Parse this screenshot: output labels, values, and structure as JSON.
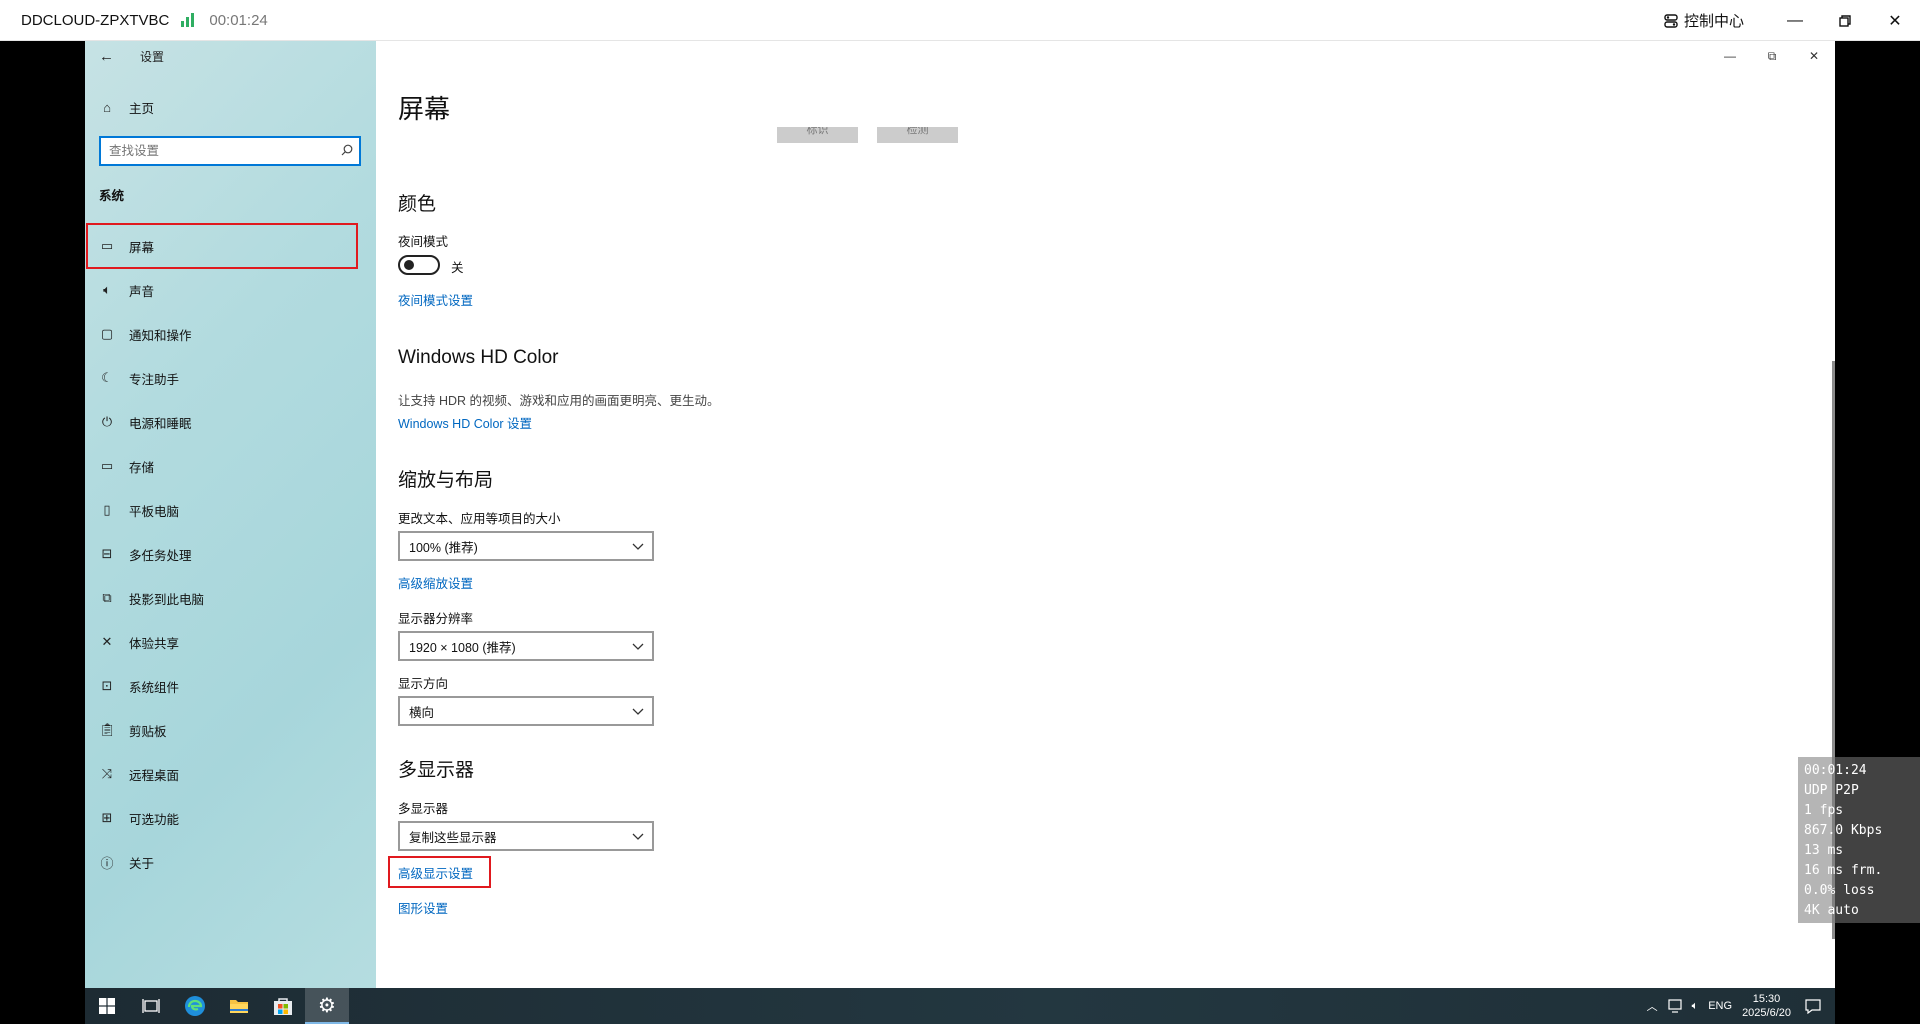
{
  "client": {
    "host": "DDCLOUD-ZPXTVBC",
    "timer": "00:01:24",
    "control_center": "控制中心",
    "signal_color": "#2fae62"
  },
  "sidebar": {
    "app_title": "设置",
    "home": "主页",
    "search_placeholder": "查找设置",
    "section": "系统",
    "items": [
      {
        "label": "屏幕",
        "icon": "monitor-icon"
      },
      {
        "label": "声音",
        "icon": "speaker-icon"
      },
      {
        "label": "通知和操作",
        "icon": "notification-icon"
      },
      {
        "label": "专注助手",
        "icon": "moon-icon"
      },
      {
        "label": "电源和睡眠",
        "icon": "power-icon"
      },
      {
        "label": "存储",
        "icon": "storage-icon"
      },
      {
        "label": "平板电脑",
        "icon": "tablet-icon"
      },
      {
        "label": "多任务处理",
        "icon": "multitask-icon"
      },
      {
        "label": "投影到此电脑",
        "icon": "project-icon"
      },
      {
        "label": "体验共享",
        "icon": "share-icon"
      },
      {
        "label": "系统组件",
        "icon": "components-icon"
      },
      {
        "label": "剪贴板",
        "icon": "clipboard-icon"
      },
      {
        "label": "远程桌面",
        "icon": "remote-desktop-icon"
      },
      {
        "label": "可选功能",
        "icon": "optional-features-icon"
      },
      {
        "label": "关于",
        "icon": "info-icon"
      }
    ]
  },
  "main": {
    "title": "屏幕",
    "partial_buttons": [
      "标识",
      "检测"
    ],
    "color": {
      "heading": "颜色",
      "night_mode_label": "夜间模式",
      "night_mode_state": "关",
      "night_mode_link": "夜间模式设置"
    },
    "hdr": {
      "heading": "Windows HD Color",
      "desc": "让支持 HDR 的视频、游戏和应用的画面更明亮、更生动。",
      "link": "Windows HD Color 设置"
    },
    "scale": {
      "heading": "缩放与布局",
      "size_label": "更改文本、应用等项目的大小",
      "size_value": "100% (推荐)",
      "advanced_link": "高级缩放设置",
      "resolution_label": "显示器分辨率",
      "resolution_value": "1920 × 1080 (推荐)",
      "orientation_label": "显示方向",
      "orientation_value": "横向"
    },
    "multi": {
      "heading": "多显示器",
      "label": "多显示器",
      "value": "复制这些显示器",
      "advanced_display_link": "高级显示设置",
      "graphics_link": "图形设置"
    }
  },
  "taskbar": {
    "lang": "ENG",
    "time": "15:30",
    "date": "2025/6/20"
  },
  "stats": [
    "00:01:24",
    "UDP P2P",
    "1 fps",
    "867.0 Kbps",
    "13 ms",
    "16 ms frm.",
    "0.0% loss",
    "4K auto"
  ]
}
